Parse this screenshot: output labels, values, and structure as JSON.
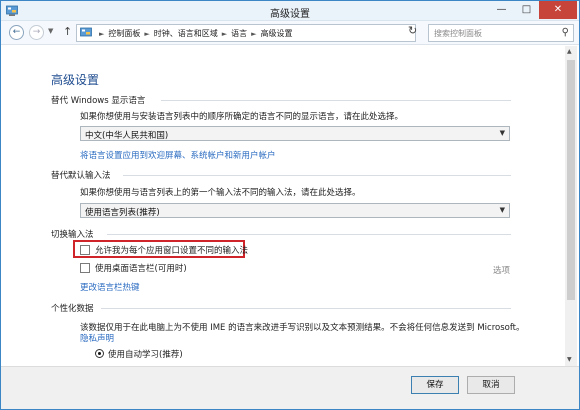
{
  "window": {
    "title": "高级设置"
  },
  "nav": {
    "breadcrumbs": [
      "控制面板",
      "时钟、语言和区域",
      "语言",
      "高级设置"
    ],
    "search_placeholder": "搜索控制面板"
  },
  "page": {
    "title": "高级设置"
  },
  "display_language": {
    "heading": "替代 Windows 显示语言",
    "description": "如果你想使用与安装语言列表中的顺序所确定的语言不同的显示语言，请在此处选择。",
    "selected": "中文(中华人民共和国)",
    "link": "将语言设置应用到欢迎屏幕、系统帐户和新用户帐户"
  },
  "default_input": {
    "heading": "替代默认输入法",
    "description": "如果你想使用与语言列表上的第一个输入法不同的输入法，请在此处选择。",
    "selected": "使用语言列表(推荐)"
  },
  "switching": {
    "heading": "切换输入法",
    "option1": "允许我为每个应用窗口设置不同的输入法",
    "option2": "使用桌面语言栏(可用时)",
    "options_link": "选项",
    "hotkeys_link": "更改语言栏热键"
  },
  "personalization": {
    "heading": "个性化数据",
    "description": "该数据仅用于在此电脑上为不使用 IME 的语言来改进手写识别以及文本预测结果。不会将任何信息发送到 Microsoft。",
    "privacy_link": "隐私声明",
    "radio_option": "使用自动学习(推荐)"
  },
  "footer": {
    "save": "保存",
    "cancel": "取消"
  }
}
